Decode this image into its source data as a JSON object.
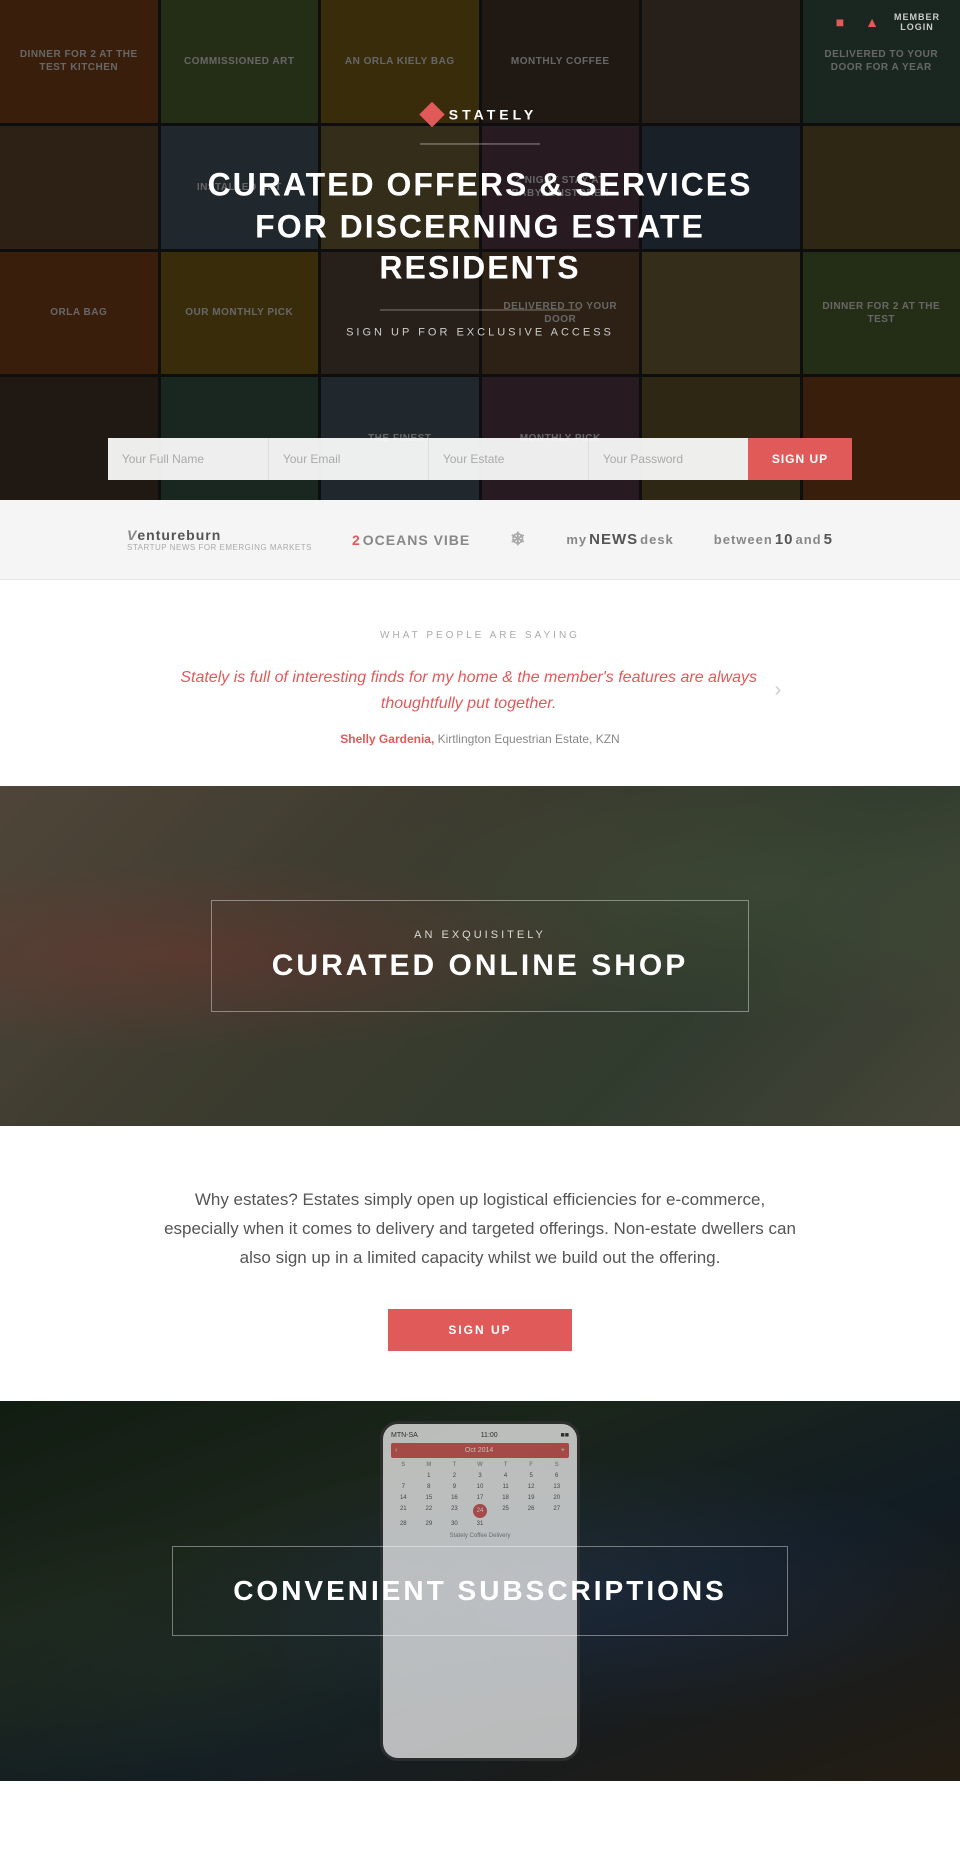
{
  "hero": {
    "logo_text": "STATELY",
    "title": "CURATED OFFERS & SERVICES FOR DISCERNING ESTATE RESIDENTS",
    "subtitle": "SIGN UP FOR EXCLUSIVE ACCESS",
    "tiles": [
      {
        "label": "DINNER FOR 2 AT THE TEST KITCHEN",
        "class": "img1"
      },
      {
        "label": "COMMISSIONED ART",
        "class": "img2"
      },
      {
        "label": "AN ORLA KIELY BAG",
        "class": "img3"
      },
      {
        "label": "MONTHLY COFFEE",
        "class": "img4"
      },
      {
        "label": "",
        "class": "img5"
      },
      {
        "label": "DELIVERED TO YOUR DOOR FOR A YEAR",
        "class": "img6"
      },
      {
        "label": "",
        "class": "img7"
      },
      {
        "label": "INSTALLED ART",
        "class": "img8"
      },
      {
        "label": "",
        "class": "img9"
      },
      {
        "label": "2 NIGHT STAY AT BABYLONSTOREN",
        "class": "img10"
      },
      {
        "label": "",
        "class": "img11"
      },
      {
        "label": "",
        "class": "img12"
      },
      {
        "label": "ORLA BAG",
        "class": "img1"
      },
      {
        "label": "OUR MONTHLY PICK",
        "class": "img3"
      },
      {
        "label": "",
        "class": "img5"
      },
      {
        "label": "DELIVERED TO YOUR DOOR",
        "class": "img7"
      },
      {
        "label": "",
        "class": "img9"
      },
      {
        "label": "DINNER FOR 2 AT THE TEST",
        "class": "img2"
      },
      {
        "label": "",
        "class": "img4"
      },
      {
        "label": "",
        "class": "img6"
      },
      {
        "label": "THE FINEST",
        "class": "img8"
      },
      {
        "label": "MONTHLY PICK",
        "class": "img10"
      },
      {
        "label": "",
        "class": "img12"
      },
      {
        "label": "",
        "class": "img1"
      }
    ],
    "form": {
      "name_placeholder": "Your Full Name",
      "email_placeholder": "Your Email",
      "estate_placeholder": "Your Estate",
      "password_placeholder": "Your Password",
      "signup_label": "SIGN UP"
    }
  },
  "nav": {
    "member_login": "MEMBER\nLOGIN",
    "facebook_icon": "f",
    "twitter_icon": "t"
  },
  "press": {
    "logos": [
      {
        "text": "Ventureburn",
        "sub": "STARTUP NEWS FOR EMERGING MARKETS",
        "type": "text"
      },
      {
        "text": "2OCEANS VIBE",
        "type": "text"
      },
      {
        "text": "❄",
        "type": "snowflake"
      },
      {
        "text": "myNEWSdesk",
        "type": "text"
      },
      {
        "text": "between10and5",
        "type": "text"
      }
    ]
  },
  "testimonial": {
    "section_label": "WHAT PEOPLE ARE SAYING",
    "quote": "Stately is full of interesting finds for my home & the member's features are always thoughtfully put together.",
    "author_name": "Shelly Gardenia,",
    "author_location": "Kirtlington Equestrian Estate, KZN"
  },
  "shop": {
    "subtitle": "AN EXQUISITELY",
    "title": "CURATED ONLINE SHOP"
  },
  "why": {
    "text": "Why estates? Estates simply open up logistical efficiencies for e-commerce, especially when it comes to delivery and targeted offerings. Non-estate dwellers can also sign up in a limited capacity whilst we build out the offering.",
    "signup_label": "SIGN UP"
  },
  "subscriptions": {
    "title": "CONVENIENT SUBSCRIPTIONS",
    "phone": {
      "status_left": "MTN-SA",
      "status_time": "11:00",
      "calendar_header": "Oct 2014",
      "days_header": [
        "S",
        "M",
        "T",
        "W",
        "T",
        "F",
        "S"
      ],
      "weeks": [
        [
          "",
          "1",
          "2",
          "3",
          "4",
          "5",
          "6"
        ],
        [
          "7",
          "8",
          "9",
          "10",
          "11",
          "12",
          "13"
        ],
        [
          "14",
          "15",
          "16",
          "17",
          "18",
          "19",
          "20"
        ],
        [
          "21",
          "22",
          "23",
          "24",
          "25",
          "26",
          "27"
        ],
        [
          "28",
          "29",
          "30",
          "31",
          "",
          "",
          ""
        ]
      ],
      "today": "24",
      "footer": "Stately Coffee Delivery"
    }
  }
}
